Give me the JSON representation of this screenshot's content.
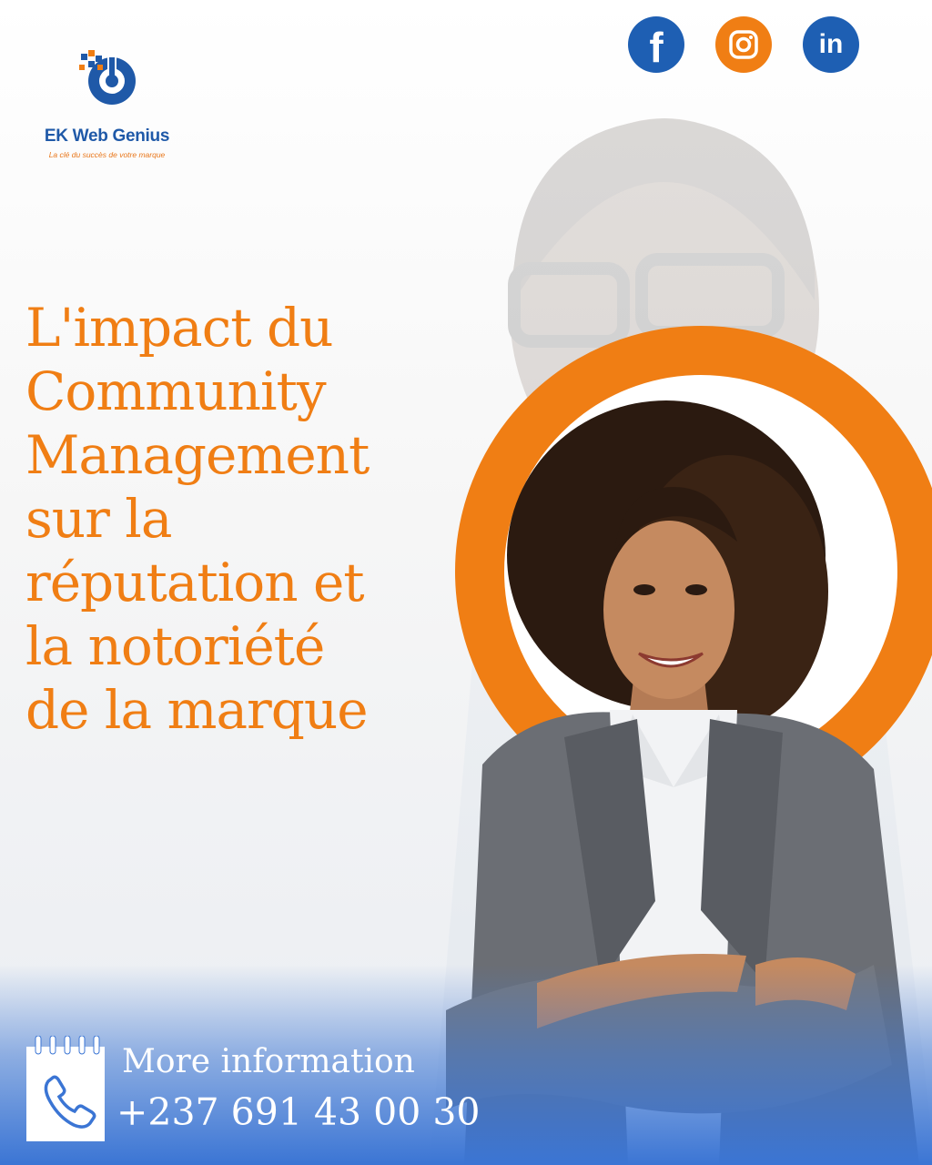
{
  "brand": {
    "name": "EK Web Genius",
    "tagline": "La clé du succès de votre marque"
  },
  "social": [
    {
      "name": "facebook",
      "glyph": "f",
      "color": "#1e5fb3"
    },
    {
      "name": "instagram",
      "glyph": "",
      "color": "#f07e14"
    },
    {
      "name": "linkedin",
      "glyph": "in",
      "color": "#1e5fb3"
    }
  ],
  "headline": {
    "lines": [
      "L'impact du",
      "Community",
      "Management",
      "sur la",
      "réputation et",
      "la notoriété",
      "de la marque"
    ],
    "color": "#f07e14"
  },
  "contact": {
    "label": "More information",
    "phone": "+237 691 43 00 30"
  },
  "colors": {
    "accent_orange": "#f07e14",
    "brand_blue": "#1e5fb3",
    "bottom_blue": "#3b75d4"
  }
}
